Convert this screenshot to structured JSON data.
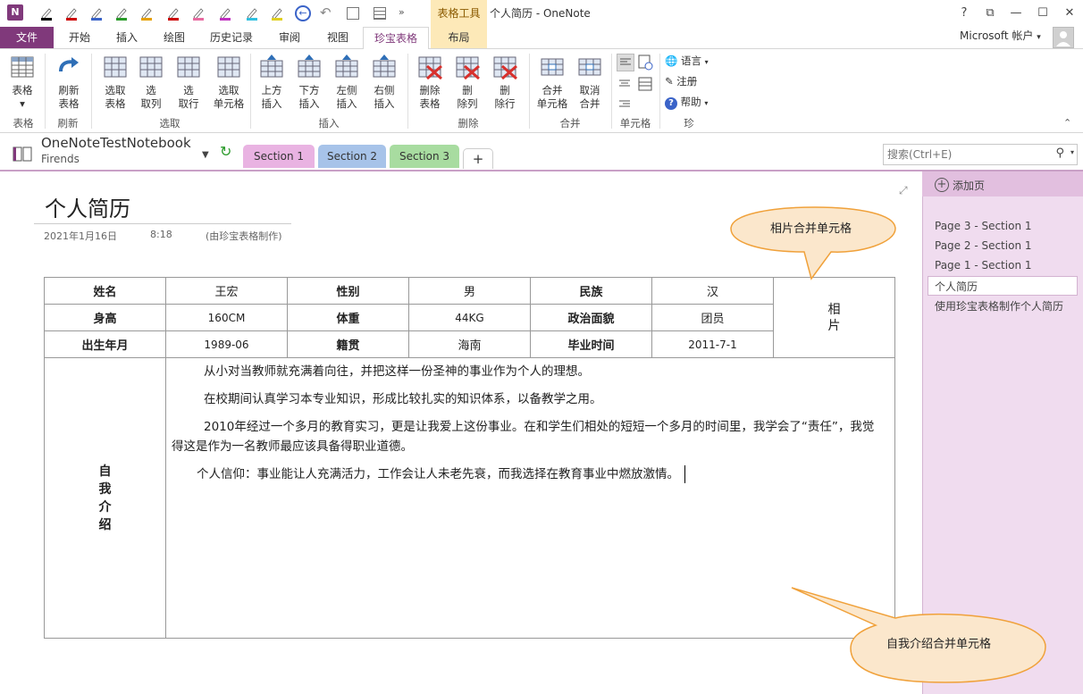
{
  "titlebar": {
    "logo": "N",
    "table_tools": "表格工具",
    "title": "个人简历 - OneNote",
    "help": "?",
    "restore": "⧉",
    "minimize": "—",
    "maximize": "☐",
    "close": "✕",
    "pen_colors": [
      "#000000",
      "#cc0000",
      "#3a63c8",
      "#2a9a2a",
      "#e6a000",
      "#cc0000",
      "#e86aa0",
      "#c030c0",
      "#30c0e0",
      "#e0d020"
    ]
  },
  "tabs": {
    "file": "文件",
    "items": [
      "开始",
      "插入",
      "绘图",
      "历史记录",
      "审阅",
      "视图",
      "珍宝表格",
      "布局"
    ],
    "account": "Microsoft 帐户",
    "collapse": "⌃"
  },
  "ribbon": {
    "buttons": [
      {
        "label1": "表格",
        "label2": "▾"
      },
      {
        "label1": "刷新",
        "label2": "表格"
      },
      {
        "label1": "选取",
        "label2": "表格"
      },
      {
        "label1": "选",
        "label2": "取列"
      },
      {
        "label1": "选",
        "label2": "取行"
      },
      {
        "label1": "选取",
        "label2": "单元格"
      },
      {
        "label1": "上方",
        "label2": "插入"
      },
      {
        "label1": "下方",
        "label2": "插入"
      },
      {
        "label1": "左侧",
        "label2": "插入"
      },
      {
        "label1": "右侧",
        "label2": "插入"
      },
      {
        "label1": "删除",
        "label2": "表格"
      },
      {
        "label1": "删",
        "label2": "除列"
      },
      {
        "label1": "删",
        "label2": "除行"
      },
      {
        "label1": "合并",
        "label2": "单元格"
      },
      {
        "label1": "取消",
        "label2": "合并"
      }
    ],
    "groups": [
      "表格",
      "刷新",
      "选取",
      "插入",
      "删除",
      "合并",
      "单元格",
      "珍"
    ],
    "small": {
      "language": "语言",
      "note": "注册",
      "help": "帮助"
    }
  },
  "notebook": {
    "name": "OneNoteTestNotebook",
    "sub": "Firends",
    "sections": [
      "Section 1",
      "Section 2",
      "Section 3"
    ],
    "add_section": "+",
    "search_placeholder": "搜索(Ctrl+E)"
  },
  "pages": {
    "add_page": "添加页",
    "items": [
      "Page 3 - Section 1",
      "Page 2 - Section 1",
      "Page 1 - Section 1",
      "个人简历",
      "使用珍宝表格制作个人简历"
    ]
  },
  "page": {
    "title": "个人简历",
    "date": "2021年1月16日",
    "time": "8:18",
    "note": "(由珍宝表格制作)"
  },
  "resume": {
    "row1": [
      "姓名",
      "王宏",
      "性别",
      "男",
      "民族",
      "汉"
    ],
    "row2": [
      "身高",
      "160CM",
      "体重",
      "44KG",
      "政治面貌",
      "团员"
    ],
    "row3": [
      "出生年月",
      "1989-06",
      "籍贯",
      "海南",
      "毕业时间",
      "2011-7-1"
    ],
    "photo": "相片",
    "intro_label": "自我介绍",
    "intro": [
      "从小对当教师就充满着向往，并把这样一份圣神的事业作为个人的理想。",
      "在校期间认真学习本专业知识，形成比较扎实的知识体系，以备教学之用。",
      "2010年经过一个多月的教育实习，更是让我爱上这份事业。在和学生们相处的短短一个多月的时间里，我学会了“责任”，我觉得这是作为一名教师最应该具备得职业道德。",
      "个人信仰：事业能让人充满活力，工作会让人未老先衰，而我选择在教育事业中燃放激情。"
    ]
  },
  "callouts": {
    "photo_merge": "相片合并单元格",
    "intro_merge": "自我介绍合并单元格"
  },
  "colors": {
    "brand": "#80397b",
    "section1": "#e9b3e2",
    "section2": "#a7c3e9",
    "section3": "#a8dca0",
    "callout_fill": "#fbe7cc",
    "callout_border": "#f0a13a"
  }
}
